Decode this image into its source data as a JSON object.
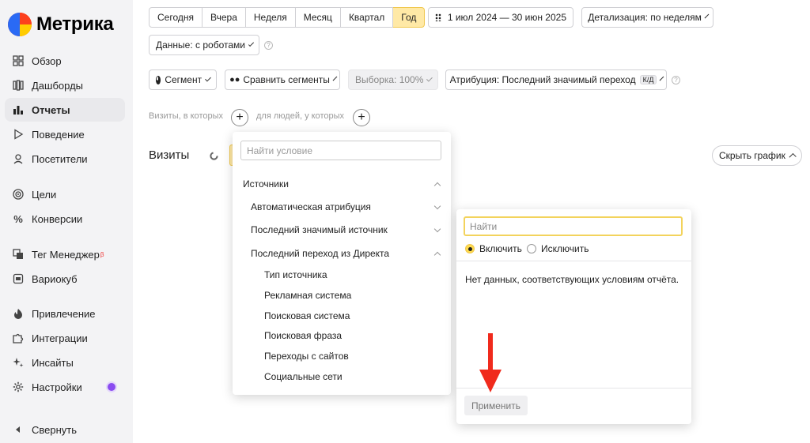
{
  "brand": {
    "name": "Метрика"
  },
  "sidebar": {
    "items": [
      {
        "label": "Обзор",
        "icon": "grid-icon"
      },
      {
        "label": "Дашборды",
        "icon": "dashboards-icon"
      },
      {
        "label": "Отчеты",
        "icon": "reports-icon",
        "active": true
      },
      {
        "label": "Поведение",
        "icon": "play-icon"
      },
      {
        "label": "Посетители",
        "icon": "user-icon"
      },
      {
        "label": "Цели",
        "icon": "target-icon"
      },
      {
        "label": "Конверсии",
        "icon": "percent-icon"
      },
      {
        "label": "Тег Менеджер",
        "icon": "tag-manager-icon",
        "badge": "β"
      },
      {
        "label": "Вариокуб",
        "icon": "variocube-icon"
      },
      {
        "label": "Привлечение",
        "icon": "fire-icon"
      },
      {
        "label": "Интеграции",
        "icon": "puzzle-icon"
      },
      {
        "label": "Инсайты",
        "icon": "sparkle-icon"
      },
      {
        "label": "Настройки",
        "icon": "gear-icon"
      },
      {
        "label": "Свернуть",
        "icon": "collapse-icon"
      }
    ]
  },
  "toolbar": {
    "periods": [
      "Сегодня",
      "Вчера",
      "Неделя",
      "Месяц",
      "Квартал",
      "Год"
    ],
    "active_period": "Год",
    "date_range": "1 июл 2024 — 30 июн 2025",
    "detail": "Детализация: по неделям",
    "data": "Данные: с роботами",
    "segment": "Сегмент",
    "compare": "Сравнить сегменты",
    "sample": "Выборка: 100%",
    "attribution": "Атрибуция: Последний значимый переход",
    "attribution_kbd": "К/Д"
  },
  "conditions": {
    "visits_label": "Визиты, в которых",
    "people_label": "для людей, у которых"
  },
  "main": {
    "title": "Визиты",
    "hide_chart": "Скрыть график"
  },
  "dropdown_conditions": {
    "search_placeholder": "Найти условие",
    "items": [
      {
        "label": "Источники",
        "level": 0,
        "chevron": "up"
      },
      {
        "label": "Автоматическая атрибуция",
        "level": 1,
        "chevron": "down"
      },
      {
        "label": "Последний значимый источник",
        "level": 1,
        "chevron": "down"
      },
      {
        "label": "Последний переход из Директа",
        "level": 1,
        "chevron": "up"
      },
      {
        "label": "Тип источника",
        "level": 2
      },
      {
        "label": "Рекламная система",
        "level": 2
      },
      {
        "label": "Поисковая система",
        "level": 2
      },
      {
        "label": "Поисковая фраза",
        "level": 2
      },
      {
        "label": "Переходы с сайтов",
        "level": 2
      },
      {
        "label": "Социальные сети",
        "level": 2
      }
    ]
  },
  "dropdown_values": {
    "search_placeholder": "Найти",
    "include": "Включить",
    "exclude": "Исключить",
    "selected": "include",
    "no_data": "Нет данных, соответствующих условиям отчёта.",
    "apply": "Применить"
  },
  "colors": {
    "active_period_bg": "#ffe9a6",
    "focus_border": "#f3d35c",
    "arrow": "#f02a1c",
    "settings_dot": "#8a4cf0"
  }
}
